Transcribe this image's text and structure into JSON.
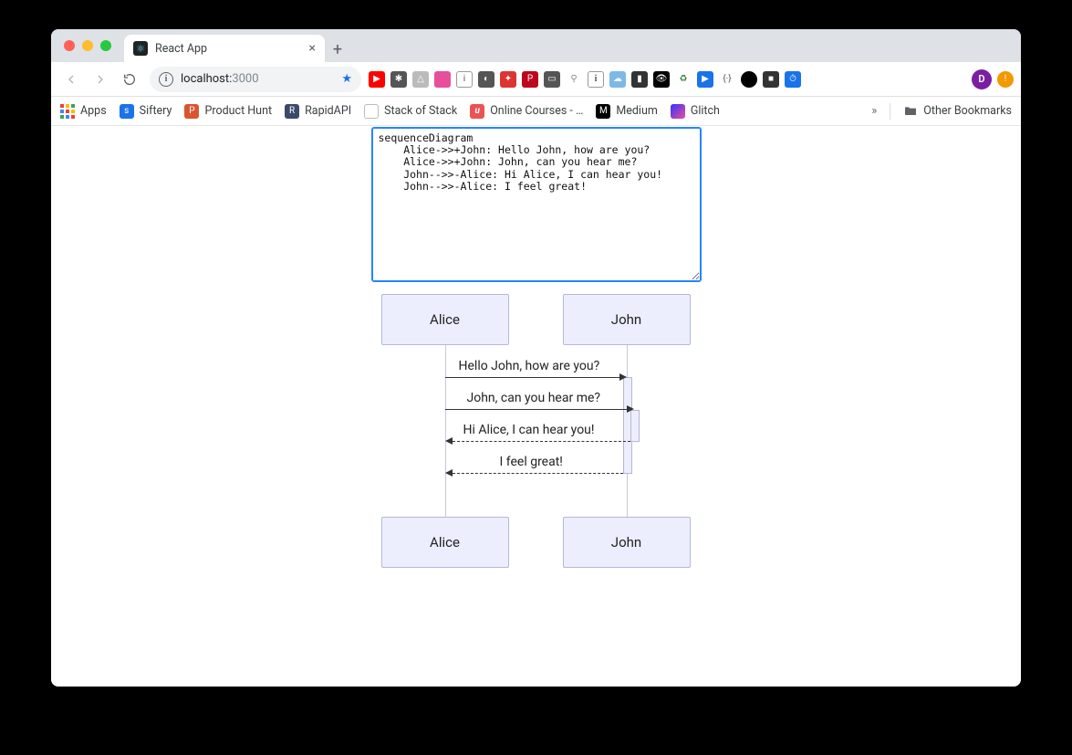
{
  "browser": {
    "tab_title": "React App",
    "url_host": "localhost:",
    "url_port": "3000",
    "newtab": "+",
    "close": "×"
  },
  "bookmarks_bar": {
    "apps": "Apps",
    "items": [
      {
        "label": "Siftery",
        "bg": "#1a73e8",
        "ch": "s"
      },
      {
        "label": "Product Hunt",
        "bg": "#da552f",
        "ch": "P"
      },
      {
        "label": "RapidAPI",
        "bg": "#3b4a6b",
        "ch": "R"
      },
      {
        "label": "Stack of Stack",
        "bg": "#e8eaed",
        "ch": ""
      },
      {
        "label": "Online Courses - …",
        "bg": "#ec5252",
        "ch": "U"
      },
      {
        "label": "Medium",
        "bg": "#000",
        "ch": "M"
      },
      {
        "label": "Glitch",
        "bg": "#e84f9a",
        "ch": ""
      }
    ],
    "overflow": "»",
    "other": "Other Bookmarks"
  },
  "editor": {
    "value": "sequenceDiagram\n    Alice->>+John: Hello John, how are you?\n    Alice->>+John: John, can you hear me?\n    John-->>-Alice: Hi Alice, I can hear you!\n    John-->>-Alice: I feel great!"
  },
  "diagram": {
    "actors": [
      "Alice",
      "John"
    ],
    "messages": [
      {
        "text": "Hello John, how are you?",
        "dir": "r",
        "style": "solid"
      },
      {
        "text": "John, can you hear me?",
        "dir": "r",
        "style": "solid"
      },
      {
        "text": "Hi Alice, I can hear you!",
        "dir": "l",
        "style": "dashed"
      },
      {
        "text": "I feel great!",
        "dir": "l",
        "style": "dashed"
      }
    ]
  },
  "avatar_initial": "D",
  "chart_data": {
    "type": "sequence",
    "actors": [
      "Alice",
      "John"
    ],
    "messages": [
      {
        "from": "Alice",
        "to": "John",
        "text": "Hello John, how are you?",
        "arrow": "solid",
        "activate": true
      },
      {
        "from": "Alice",
        "to": "John",
        "text": "John, can you hear me?",
        "arrow": "solid",
        "activate": true
      },
      {
        "from": "John",
        "to": "Alice",
        "text": "Hi Alice, I can hear you!",
        "arrow": "dashed",
        "deactivate": true
      },
      {
        "from": "John",
        "to": "Alice",
        "text": "I feel great!",
        "arrow": "dashed",
        "deactivate": true
      }
    ]
  }
}
